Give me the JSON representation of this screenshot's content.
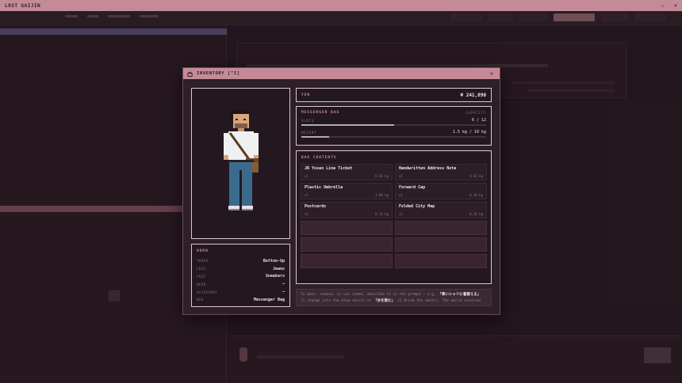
{
  "window": {
    "title": "LOST GAIJIN",
    "minimize": "–",
    "close": "✕"
  },
  "modal": {
    "title": "INVENTORY [^I]",
    "close": "✕",
    "yen": {
      "label": "YEN",
      "value": "¥ 241,890"
    },
    "bag": {
      "title": "MESSENGER BAG",
      "capacity_label": "CAPACITY",
      "slots_label": "SLOTS",
      "slots_value": "6 / 12",
      "slots_fraction": 0.5,
      "weight_label": "WEIGHT",
      "weight_value": "1.5 kg / 10 kg",
      "weight_fraction": 0.15
    },
    "contents": {
      "title": "BAG CONTENTS",
      "items": [
        {
          "name": "JR Yosan Line Ticket",
          "qty": "x1",
          "weight": "0.01 kg"
        },
        {
          "name": "Handwritten Address Note",
          "qty": "x1",
          "weight": "0.01 kg"
        },
        {
          "name": "Plastic Umbrella",
          "qty": "x1",
          "weight": "1.00 kg"
        },
        {
          "name": "Forward Cap",
          "qty": "x1",
          "weight": "0.10 kg"
        },
        {
          "name": "Postcards",
          "qty": "x3",
          "weight": "0.15 kg"
        },
        {
          "name": "Folded City Map",
          "qty": "x1",
          "weight": "0.20 kg"
        }
      ]
    },
    "worn": {
      "title": "WORN",
      "rows": [
        {
          "slot": "TORSO",
          "item": "Button-Up"
        },
        {
          "slot": "LEGS",
          "item": "Jeans"
        },
        {
          "slot": "FEET",
          "item": "Sneakers"
        },
        {
          "slot": "HEAD",
          "item": "—"
        },
        {
          "slot": "ACCESSORY",
          "item": "—"
        },
        {
          "slot": "BAG",
          "item": "Messenger Bag"
        }
      ]
    },
    "hint": {
      "part1": "To wear, remove, or use items, describe it in the prompt — e.g.",
      "example1": "「青いシャツに着替える」",
      "part2": "(I change into the blue shirt) or",
      "example2": "「水を飲む」",
      "part3": "(I drink the water). The world resolves it"
    }
  }
}
